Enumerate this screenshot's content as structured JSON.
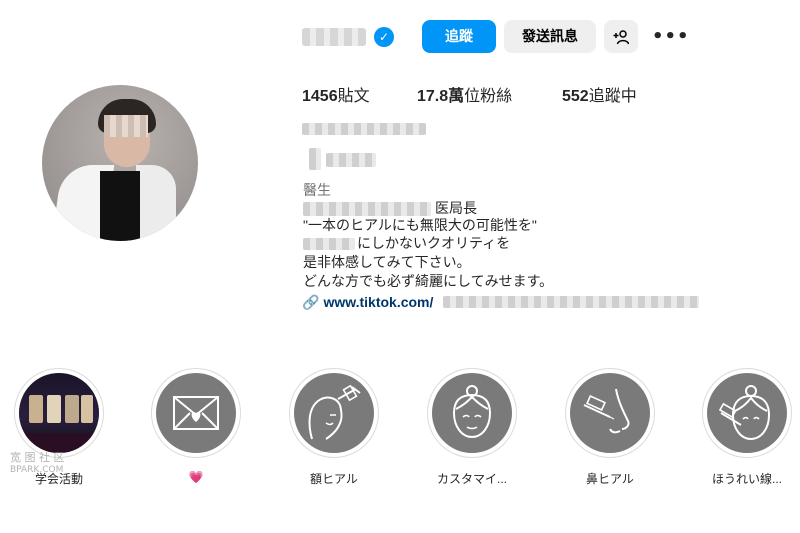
{
  "profile": {
    "follow_label": "追蹤",
    "message_label": "發送訊息",
    "add_user_glyph": "+👤",
    "more_glyph": "•••"
  },
  "stats": {
    "posts_count": "1456",
    "posts_unit": "貼文",
    "followers_count": "17.8萬",
    "followers_unit": "位粉絲",
    "following_count": "552",
    "following_unit": "追蹤中"
  },
  "bio": {
    "category": "醫生",
    "line_title_suffix": "医局長",
    "line_quote": "\"一本のヒアルにも無限大の可能性を\"",
    "line_quality": "にしかないクオリティを",
    "line_experience": "是非体感してみて下さい。",
    "line_promise": "どんな方でも必ず綺麗にしてみせます。",
    "link_text": "www.tiktok.com/"
  },
  "highlights": [
    {
      "label": "学会活動",
      "icon": "stage-photo"
    },
    {
      "label": "💗",
      "icon": "envelope-heart-icon"
    },
    {
      "label": "額ヒアル",
      "icon": "forehead-injection-icon"
    },
    {
      "label": "カスタマイ...",
      "icon": "face-icon"
    },
    {
      "label": "鼻ヒアル",
      "icon": "nose-injection-icon"
    },
    {
      "label": "ほうれい線...",
      "icon": "nasolabial-injection-icon"
    }
  ],
  "watermark": {
    "line1": "宽 图 社 区",
    "line2": "BPARK.COM"
  },
  "colors": {
    "accent": "#0095f6",
    "button_gray": "#efefef",
    "link": "#00376b",
    "highlight_fill": "#7a7a7a"
  }
}
